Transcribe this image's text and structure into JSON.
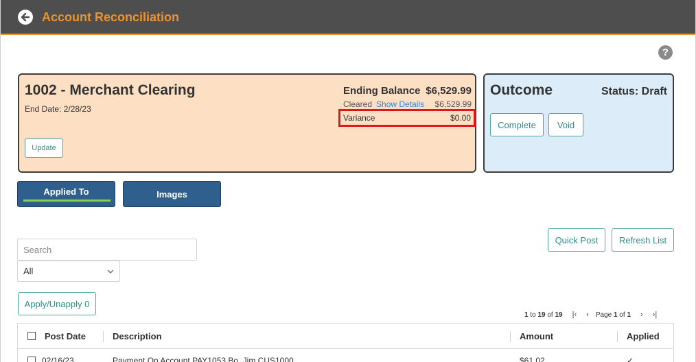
{
  "header": {
    "title": "Account Reconciliation",
    "back_icon": "back-arrow-circle-icon"
  },
  "help": {
    "glyph": "?"
  },
  "account": {
    "name": "1002 - Merchant Clearing",
    "end_date": "End Date: 2/28/23",
    "update_label": "Update",
    "ending_balance_label": "Ending Balance",
    "ending_balance_value": "$6,529.99",
    "cleared_label": "Cleared",
    "show_details_label": "Show Details",
    "cleared_value": "$6,529.99",
    "variance_label": "Variance",
    "variance_value": "$0.00",
    "background_color": "#fddfc4"
  },
  "outcome": {
    "title": "Outcome",
    "status": "Status: Draft",
    "complete_label": "Complete",
    "void_label": "Void",
    "background_color": "#dcecf8"
  },
  "tabs": [
    {
      "label": "Applied To",
      "active": true
    },
    {
      "label": "Images",
      "active": false
    }
  ],
  "actions": {
    "quick_post_label": "Quick Post",
    "refresh_list_label": "Refresh List",
    "apply_unapply_label": "Apply/Unapply 0"
  },
  "search": {
    "placeholder": "Search",
    "value": ""
  },
  "filter": {
    "selected": "All"
  },
  "pager": {
    "range_start": "1",
    "to_text": " to ",
    "range_end": "19",
    "of_text": " of ",
    "total": "19",
    "page_word": "Page ",
    "page": "1",
    "page_of": " of ",
    "page_total": "1",
    "first_glyph": "|‹",
    "prev_glyph": "‹",
    "next_glyph": "›",
    "last_glyph": "›|"
  },
  "table": {
    "columns": [
      "Post Date",
      "Description",
      "Amount",
      "Applied"
    ],
    "rows": [
      {
        "post_date": "02/16/23",
        "description": "Payment On Account PAY1053 Bo, Jim CUS1000",
        "amount": "$61.02",
        "applied": "✓"
      }
    ]
  },
  "colors": {
    "header_bg": "#4e4e4e",
    "title_accent": "#f0922b",
    "tab_bg": "#2f5f8c",
    "tab_active_underline": "#8bcf5a",
    "button_outline": "#4aa6a0",
    "variance_highlight": "#e01818"
  }
}
